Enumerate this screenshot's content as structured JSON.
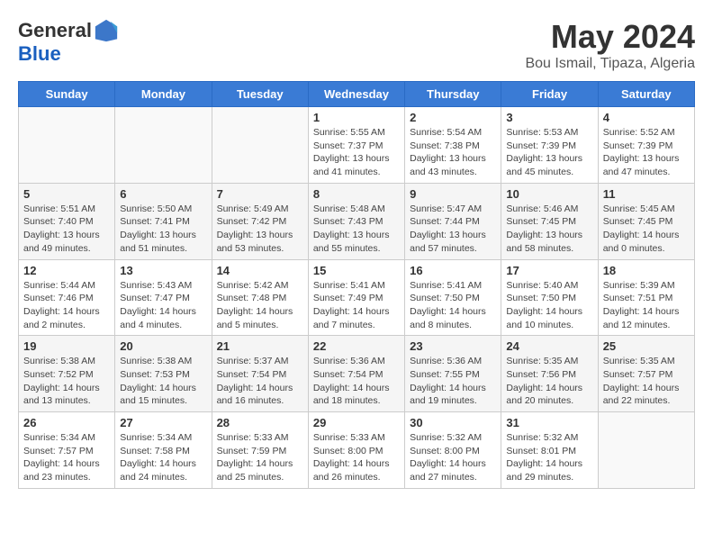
{
  "header": {
    "logo_line1": "General",
    "logo_line2": "Blue",
    "month_title": "May 2024",
    "location": "Bou Ismail, Tipaza, Algeria"
  },
  "weekdays": [
    "Sunday",
    "Monday",
    "Tuesday",
    "Wednesday",
    "Thursday",
    "Friday",
    "Saturday"
  ],
  "weeks": [
    [
      {
        "day": "",
        "info": ""
      },
      {
        "day": "",
        "info": ""
      },
      {
        "day": "",
        "info": ""
      },
      {
        "day": "1",
        "info": "Sunrise: 5:55 AM\nSunset: 7:37 PM\nDaylight: 13 hours\nand 41 minutes."
      },
      {
        "day": "2",
        "info": "Sunrise: 5:54 AM\nSunset: 7:38 PM\nDaylight: 13 hours\nand 43 minutes."
      },
      {
        "day": "3",
        "info": "Sunrise: 5:53 AM\nSunset: 7:39 PM\nDaylight: 13 hours\nand 45 minutes."
      },
      {
        "day": "4",
        "info": "Sunrise: 5:52 AM\nSunset: 7:39 PM\nDaylight: 13 hours\nand 47 minutes."
      }
    ],
    [
      {
        "day": "5",
        "info": "Sunrise: 5:51 AM\nSunset: 7:40 PM\nDaylight: 13 hours\nand 49 minutes."
      },
      {
        "day": "6",
        "info": "Sunrise: 5:50 AM\nSunset: 7:41 PM\nDaylight: 13 hours\nand 51 minutes."
      },
      {
        "day": "7",
        "info": "Sunrise: 5:49 AM\nSunset: 7:42 PM\nDaylight: 13 hours\nand 53 minutes."
      },
      {
        "day": "8",
        "info": "Sunrise: 5:48 AM\nSunset: 7:43 PM\nDaylight: 13 hours\nand 55 minutes."
      },
      {
        "day": "9",
        "info": "Sunrise: 5:47 AM\nSunset: 7:44 PM\nDaylight: 13 hours\nand 57 minutes."
      },
      {
        "day": "10",
        "info": "Sunrise: 5:46 AM\nSunset: 7:45 PM\nDaylight: 13 hours\nand 58 minutes."
      },
      {
        "day": "11",
        "info": "Sunrise: 5:45 AM\nSunset: 7:45 PM\nDaylight: 14 hours\nand 0 minutes."
      }
    ],
    [
      {
        "day": "12",
        "info": "Sunrise: 5:44 AM\nSunset: 7:46 PM\nDaylight: 14 hours\nand 2 minutes."
      },
      {
        "day": "13",
        "info": "Sunrise: 5:43 AM\nSunset: 7:47 PM\nDaylight: 14 hours\nand 4 minutes."
      },
      {
        "day": "14",
        "info": "Sunrise: 5:42 AM\nSunset: 7:48 PM\nDaylight: 14 hours\nand 5 minutes."
      },
      {
        "day": "15",
        "info": "Sunrise: 5:41 AM\nSunset: 7:49 PM\nDaylight: 14 hours\nand 7 minutes."
      },
      {
        "day": "16",
        "info": "Sunrise: 5:41 AM\nSunset: 7:50 PM\nDaylight: 14 hours\nand 8 minutes."
      },
      {
        "day": "17",
        "info": "Sunrise: 5:40 AM\nSunset: 7:50 PM\nDaylight: 14 hours\nand 10 minutes."
      },
      {
        "day": "18",
        "info": "Sunrise: 5:39 AM\nSunset: 7:51 PM\nDaylight: 14 hours\nand 12 minutes."
      }
    ],
    [
      {
        "day": "19",
        "info": "Sunrise: 5:38 AM\nSunset: 7:52 PM\nDaylight: 14 hours\nand 13 minutes."
      },
      {
        "day": "20",
        "info": "Sunrise: 5:38 AM\nSunset: 7:53 PM\nDaylight: 14 hours\nand 15 minutes."
      },
      {
        "day": "21",
        "info": "Sunrise: 5:37 AM\nSunset: 7:54 PM\nDaylight: 14 hours\nand 16 minutes."
      },
      {
        "day": "22",
        "info": "Sunrise: 5:36 AM\nSunset: 7:54 PM\nDaylight: 14 hours\nand 18 minutes."
      },
      {
        "day": "23",
        "info": "Sunrise: 5:36 AM\nSunset: 7:55 PM\nDaylight: 14 hours\nand 19 minutes."
      },
      {
        "day": "24",
        "info": "Sunrise: 5:35 AM\nSunset: 7:56 PM\nDaylight: 14 hours\nand 20 minutes."
      },
      {
        "day": "25",
        "info": "Sunrise: 5:35 AM\nSunset: 7:57 PM\nDaylight: 14 hours\nand 22 minutes."
      }
    ],
    [
      {
        "day": "26",
        "info": "Sunrise: 5:34 AM\nSunset: 7:57 PM\nDaylight: 14 hours\nand 23 minutes."
      },
      {
        "day": "27",
        "info": "Sunrise: 5:34 AM\nSunset: 7:58 PM\nDaylight: 14 hours\nand 24 minutes."
      },
      {
        "day": "28",
        "info": "Sunrise: 5:33 AM\nSunset: 7:59 PM\nDaylight: 14 hours\nand 25 minutes."
      },
      {
        "day": "29",
        "info": "Sunrise: 5:33 AM\nSunset: 8:00 PM\nDaylight: 14 hours\nand 26 minutes."
      },
      {
        "day": "30",
        "info": "Sunrise: 5:32 AM\nSunset: 8:00 PM\nDaylight: 14 hours\nand 27 minutes."
      },
      {
        "day": "31",
        "info": "Sunrise: 5:32 AM\nSunset: 8:01 PM\nDaylight: 14 hours\nand 29 minutes."
      },
      {
        "day": "",
        "info": ""
      }
    ]
  ]
}
